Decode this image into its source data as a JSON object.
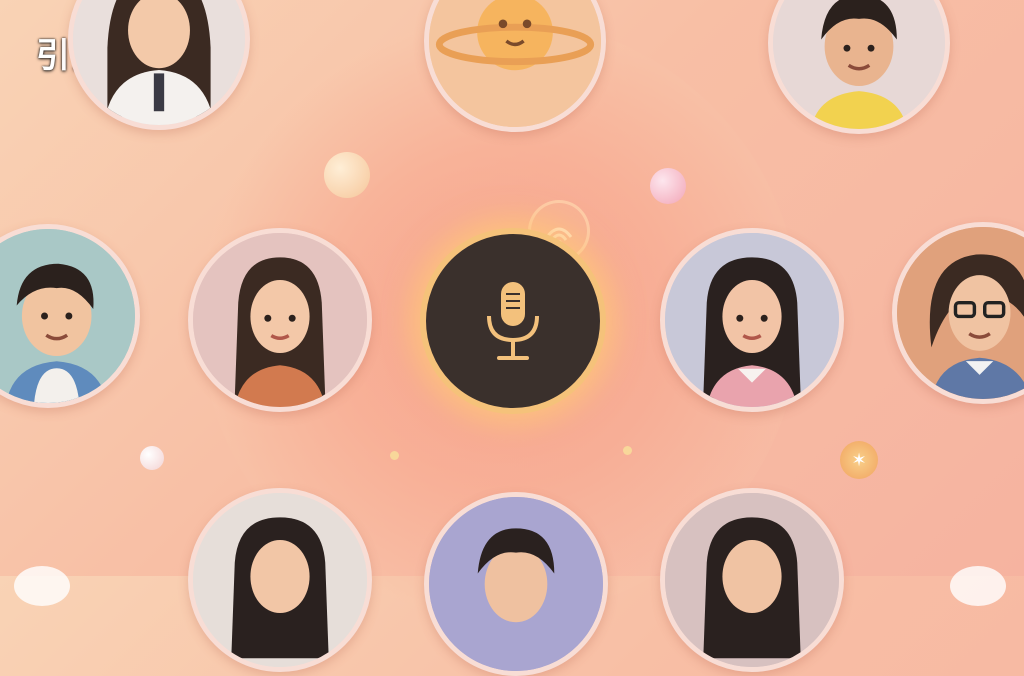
{
  "app": {
    "title": "引力星球"
  },
  "icons": {
    "mic": "microphone-icon",
    "planet": "planet-icon",
    "signal": "signal-icon",
    "star": "star-icon"
  },
  "colors": {
    "accent": "#f5c27a",
    "mic_bg": "#3a302c",
    "background": "#f8c6ad"
  },
  "avatars": [
    {
      "id": "top-left"
    },
    {
      "id": "top-center-planet"
    },
    {
      "id": "top-right"
    },
    {
      "id": "middle-far-left"
    },
    {
      "id": "middle-left"
    },
    {
      "id": "middle-right"
    },
    {
      "id": "middle-far-right"
    },
    {
      "id": "bottom-left"
    },
    {
      "id": "bottom-center"
    },
    {
      "id": "bottom-right"
    }
  ]
}
